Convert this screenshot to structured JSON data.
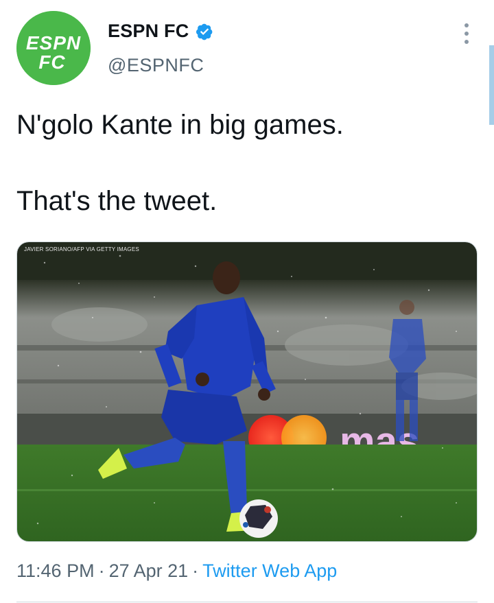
{
  "author": {
    "display_name": "ESPN FC",
    "handle": "@ESPNFC",
    "avatar_text_top": "ESPN",
    "avatar_text_bottom": "FC",
    "avatar_color": "#4ab84a"
  },
  "tweet": {
    "line1": "N'golo Kante in big games.",
    "line2": "That's the tweet."
  },
  "media": {
    "credit": "JAVIER SORIANO/AFP VIA GETTY IMAGES",
    "board_text": "mas"
  },
  "meta": {
    "time": "11:46 PM",
    "separator": "·",
    "date": "27 Apr 21",
    "source": "Twitter Web App"
  },
  "colors": {
    "link": "#1d9bf0",
    "muted": "#536471",
    "verified": "#1d9bf0"
  },
  "icons": {
    "verified": "verified-badge-icon",
    "more": "more-options-icon"
  }
}
